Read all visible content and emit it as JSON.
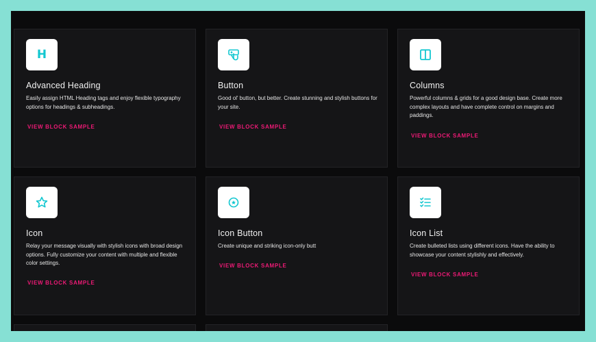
{
  "accent_color": "#12c7d0",
  "link_color": "#ec1a75",
  "cards": [
    {
      "title": "Advanced Heading",
      "icon": "heading-icon",
      "icon_glyph": "H",
      "description": "Easily assign HTML Heading tags and enjoy flexible typography options for headings & subheadings.",
      "link": "VIEW BLOCK SAMPLE"
    },
    {
      "title": "Button",
      "icon": "button-icon",
      "description": "Good ol' button, but better. Create stunning and stylish buttons for your site.",
      "link": "VIEW BLOCK SAMPLE"
    },
    {
      "title": "Columns",
      "icon": "columns-icon",
      "description": "Powerful columns & grids for a good design base. Create more complex layouts and have complete control on margins and paddings.",
      "link": "VIEW BLOCK SAMPLE"
    },
    {
      "title": "Icon",
      "icon": "star-icon",
      "description": "Relay your message visually with stylish icons with broad design options. Fully customize your content with multiple and flexible color settings.",
      "link": "VIEW BLOCK SAMPLE"
    },
    {
      "title": "Icon Button",
      "icon": "icon-button-icon",
      "description": "Create unique and striking icon-only butt",
      "link": "VIEW BLOCK SAMPLE"
    },
    {
      "title": "Icon List",
      "icon": "checklist-icon",
      "description": "Create bulleted lists using different icons. Have the ability to showcase your content stylishly and effectively.",
      "link": "VIEW BLOCK SAMPLE"
    }
  ]
}
